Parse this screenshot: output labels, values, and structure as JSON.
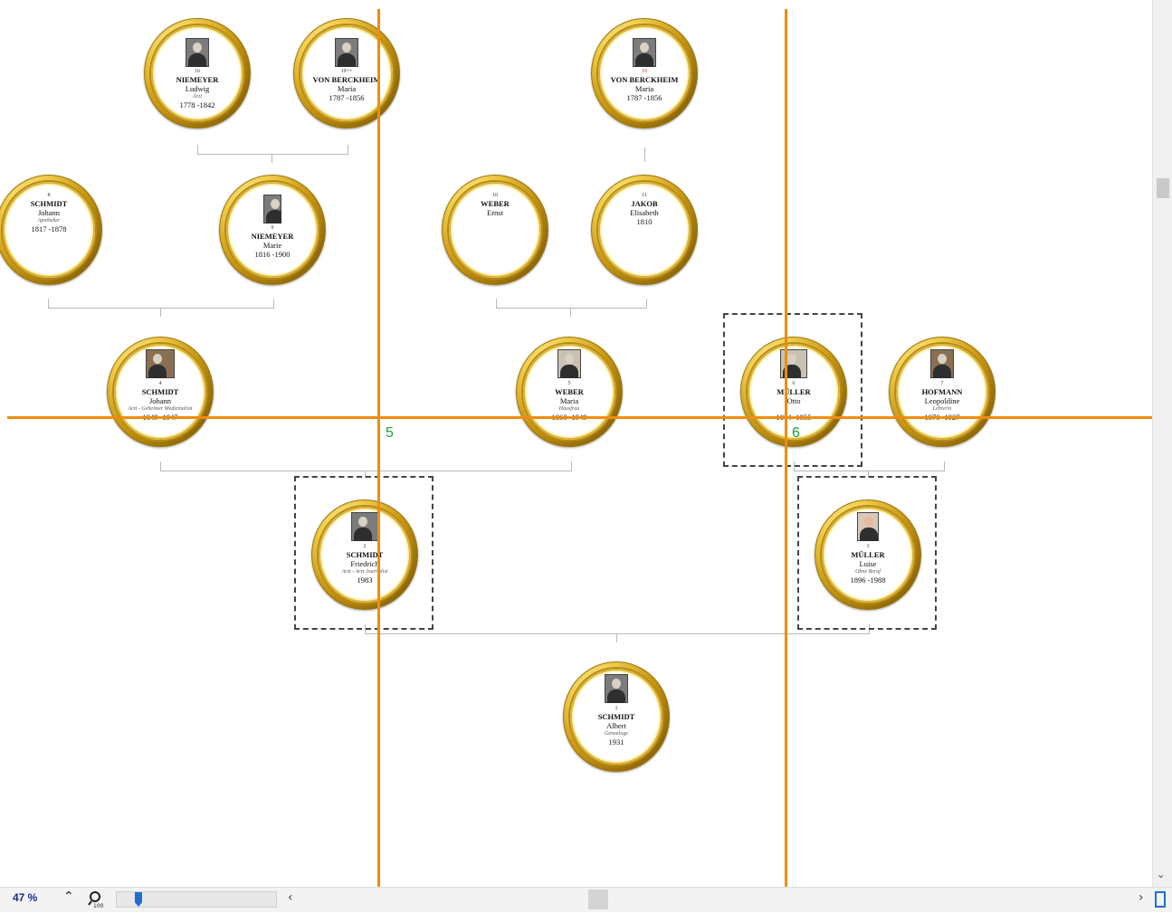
{
  "persons": [
    {
      "id": "p16",
      "number": "16",
      "surname": "NIEMEYER",
      "given": "Ludwig",
      "occupation": "Arzt",
      "dates": "1778 -1842",
      "photo": "bw"
    },
    {
      "id": "p19a",
      "number": "19++",
      "surname": "VON BERCKHEIM",
      "given": "Maria",
      "occupation": "",
      "dates": "1787 -1856",
      "photo": "bw"
    },
    {
      "id": "p19b",
      "number": "19",
      "surname": "VON BERCKHEIM",
      "given": "Maria",
      "occupation": "",
      "dates": "1787 -1856",
      "photo": "bw",
      "number_red": true
    },
    {
      "id": "p8",
      "number": "8",
      "surname": "SCHMIDT",
      "given": "Johann",
      "occupation": "Apotheker",
      "dates": "1817 -1878",
      "photo": ""
    },
    {
      "id": "p9",
      "number": "9",
      "surname": "NIEMEYER",
      "given": "Marie",
      "occupation": "",
      "dates": "1816 -1900",
      "photo": "bw"
    },
    {
      "id": "p10",
      "number": "10",
      "surname": "WEBER",
      "given": "Ernst",
      "occupation": "",
      "dates": "",
      "photo": ""
    },
    {
      "id": "p11",
      "number": "11",
      "surname": "JAKOB",
      "given": "Elisabeth",
      "occupation": "",
      "dates": "1810",
      "photo": ""
    },
    {
      "id": "p4",
      "number": "4",
      "surname": "SCHMIDT",
      "given": "Johann",
      "occupation": "Arzt - Geheimer Medizinalrat",
      "dates": "1849 -1947",
      "photo": "sepia"
    },
    {
      "id": "p5",
      "number": "5",
      "surname": "WEBER",
      "given": "Maria",
      "occupation": "Hausfrau",
      "dates": "1860 -1949",
      "photo": "light"
    },
    {
      "id": "p6",
      "number": "6",
      "surname": "MÜLLER",
      "given": "Otto",
      "occupation": "",
      "dates": "1864 -1955",
      "photo": "light"
    },
    {
      "id": "p7",
      "number": "7",
      "surname": "HOFMANN",
      "given": "Leopoldine",
      "occupation": "Lehrerin",
      "dates": "1870 -1927",
      "photo": "sepia"
    },
    {
      "id": "p2",
      "number": "2",
      "surname": "SCHMIDT",
      "given": "Friedrich",
      "occupation": "Arzt - Arzt Journalist",
      "dates": "1983",
      "photo": "bw"
    },
    {
      "id": "p3",
      "number": "3",
      "surname": "MÜLLER",
      "given": "Luise",
      "occupation": "Ohne Beruf",
      "dates": "1896 -1988",
      "photo": "color"
    },
    {
      "id": "p1",
      "number": "1",
      "surname": "SCHMIDT",
      "given": "Albert",
      "occupation": "Genealoge",
      "dates": "1931",
      "photo": "bw"
    }
  ],
  "guides": {
    "label_left": "5",
    "label_right": "6"
  },
  "status": {
    "zoom_percent": "47 %",
    "zoom_slider_fraction": 0.05
  }
}
